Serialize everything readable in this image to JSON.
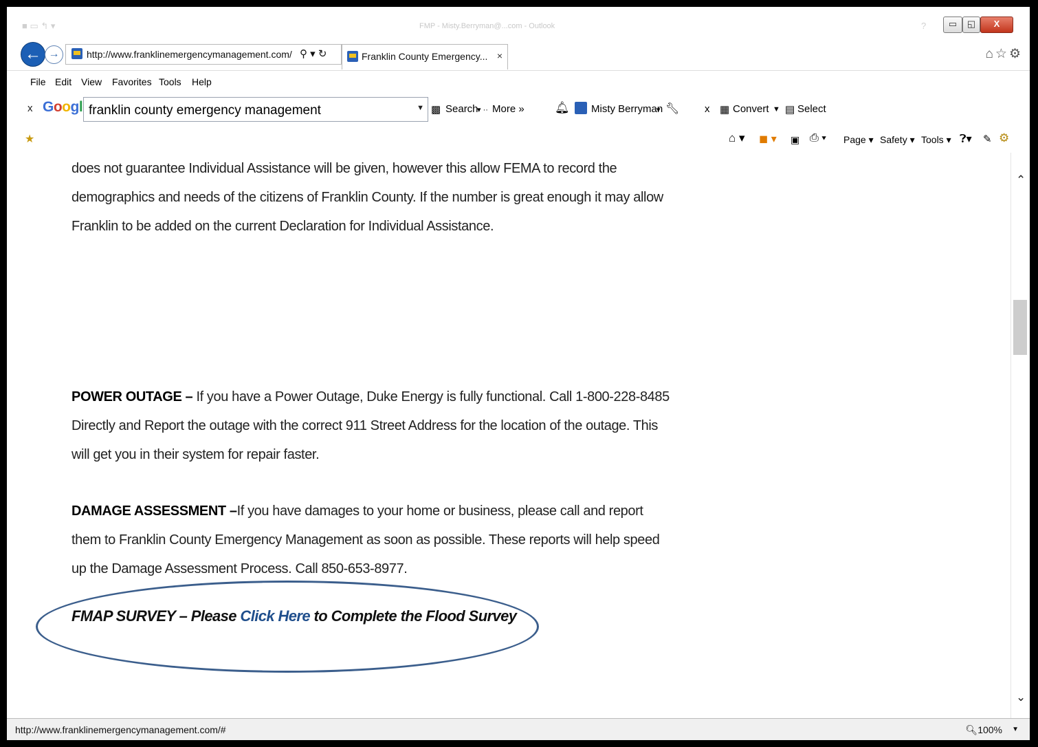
{
  "browser": {
    "window_title": "FMP - Misty.Berryman@...com - Outlook",
    "url": "http://www.franklinemergencymanagement.com/",
    "tab_title": "Franklin County Emergency...",
    "tab_close": "×",
    "window_buttons": {
      "minimize": "▭",
      "restore": "◱",
      "close": "X"
    },
    "right_icons": "⌂☆⚙"
  },
  "menu": [
    "File",
    "Edit",
    "View",
    "Favorites",
    "Tools",
    "Help"
  ],
  "google_toolbar": {
    "close": "x",
    "logo": "Google",
    "search_value": "franklin county emergency management",
    "search_label": "Search",
    "more_label": "More »",
    "user_name": "Misty Berryman",
    "convert_label": "Convert",
    "select_label": "Select"
  },
  "command_bar": {
    "page": "Page ▾",
    "safety": "Safety ▾",
    "tools": "Tools ▾"
  },
  "content": {
    "intro_paragraph": "does not guarantee Individual Assistance will be given, however this allow FEMA to record the demographics and needs of the citizens of Franklin County.  If the number is great enough it may allow Franklin to be added on the current Declaration for Individual Assistance.",
    "power_outage_heading": "POWER OUTAGE – ",
    "power_outage_text": "If you have a Power Outage, Duke Energy is fully functional. Call 1-800-228-8485 Directly and Report the outage with the correct 911 Street Address for the location of the outage. This will get you in their system for repair faster.",
    "damage_heading": "DAMAGE ASSESSMENT –",
    "damage_text": "If you have damages to your home or business, please call and report them to Franklin County Emergency Management as soon as possible. These reports will help speed up the Damage Assessment Process. Call 850-653-8977.",
    "survey_prefix": "FMAP SURVEY – Please ",
    "survey_link": "Click Here",
    "survey_suffix": " to  Complete the Flood Survey"
  },
  "status_bar": {
    "url": "http://www.franklinemergencymanagement.com/#",
    "zoom": "100%"
  }
}
